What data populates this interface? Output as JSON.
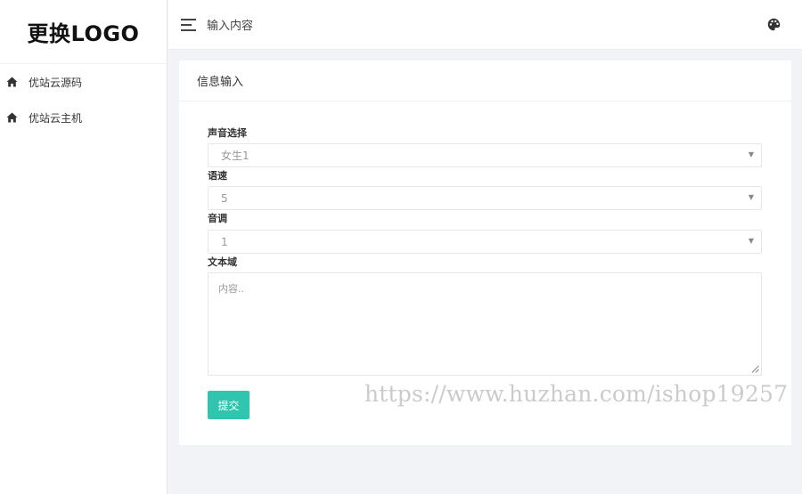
{
  "sidebar": {
    "logo": "更换LOGO",
    "items": [
      {
        "label": "优站云源码",
        "icon": "home-icon"
      },
      {
        "label": "优站云主机",
        "icon": "home-icon"
      }
    ]
  },
  "header": {
    "title": "输入内容",
    "menu_icon": "menu-icon",
    "theme_icon": "palette-icon"
  },
  "card": {
    "title": "信息输入"
  },
  "form": {
    "voice_label": "声音选择",
    "voice_value": "女生1",
    "speed_label": "语速",
    "speed_value": "5",
    "pitch_label": "音调",
    "pitch_value": "1",
    "text_label": "文本域",
    "text_placeholder": "内容..",
    "submit_label": "提交"
  },
  "watermark": "https://www.huzhan.com/ishop19257",
  "colors": {
    "accent": "#2fc5ae",
    "background": "#f2f3f7"
  }
}
